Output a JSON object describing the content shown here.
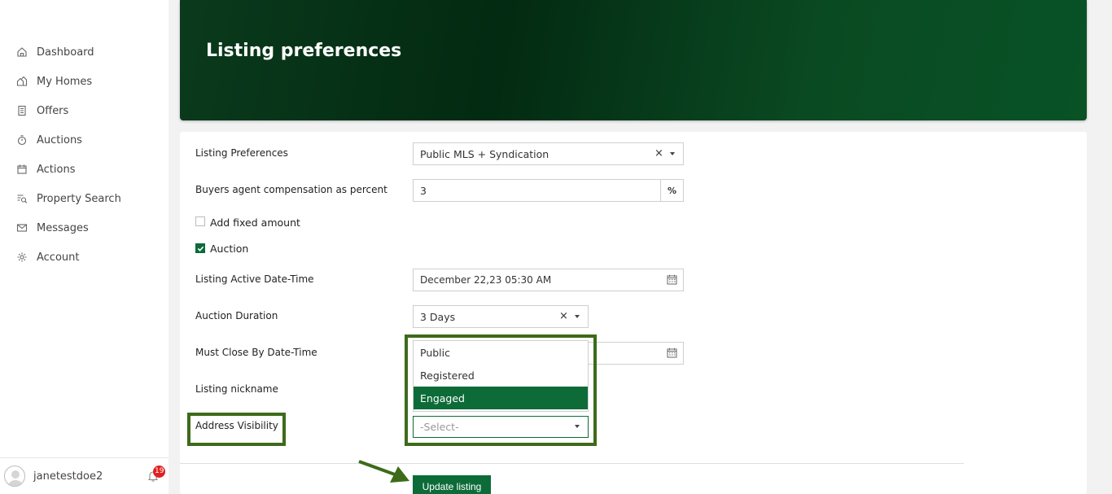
{
  "sidebar": {
    "items": [
      {
        "label": "Dashboard",
        "icon": "home-icon"
      },
      {
        "label": "My Homes",
        "icon": "houses-icon"
      },
      {
        "label": "Offers",
        "icon": "document-icon"
      },
      {
        "label": "Auctions",
        "icon": "timer-icon"
      },
      {
        "label": "Actions",
        "icon": "calendar-icon"
      },
      {
        "label": "Property Search",
        "icon": "search-list-icon"
      },
      {
        "label": "Messages",
        "icon": "mail-icon"
      },
      {
        "label": "Account",
        "icon": "gear-icon"
      }
    ],
    "user": {
      "name": "janetestdoe2",
      "notifications": "19"
    }
  },
  "header": {
    "title": "Listing preferences"
  },
  "form": {
    "listing_preferences": {
      "label": "Listing Preferences",
      "value": "Public MLS + Syndication",
      "clear": "×"
    },
    "buyers_comp": {
      "label": "Buyers agent compensation as percent",
      "value": "3",
      "unit": "%"
    },
    "add_fixed": {
      "label": "Add fixed amount",
      "checked": false
    },
    "auction": {
      "label": "Auction",
      "checked": true
    },
    "active_date": {
      "label": "Listing Active Date-Time",
      "value": "December 22,23 05:30 AM"
    },
    "auction_duration": {
      "label": "Auction Duration",
      "value": "3 Days",
      "clear": "×"
    },
    "must_close": {
      "label": "Must Close By Date-Time"
    },
    "nickname": {
      "label": "Listing nickname"
    },
    "address_visibility": {
      "label": "Address Visibility",
      "placeholder": "-Select-",
      "options": [
        "Public",
        "Registered",
        "Engaged"
      ],
      "highlighted": "Engaged"
    },
    "submit_label": "Update listing"
  },
  "colors": {
    "brand": "#0d6b38",
    "highlight": "#3d6b1a",
    "badge": "#e02020"
  }
}
